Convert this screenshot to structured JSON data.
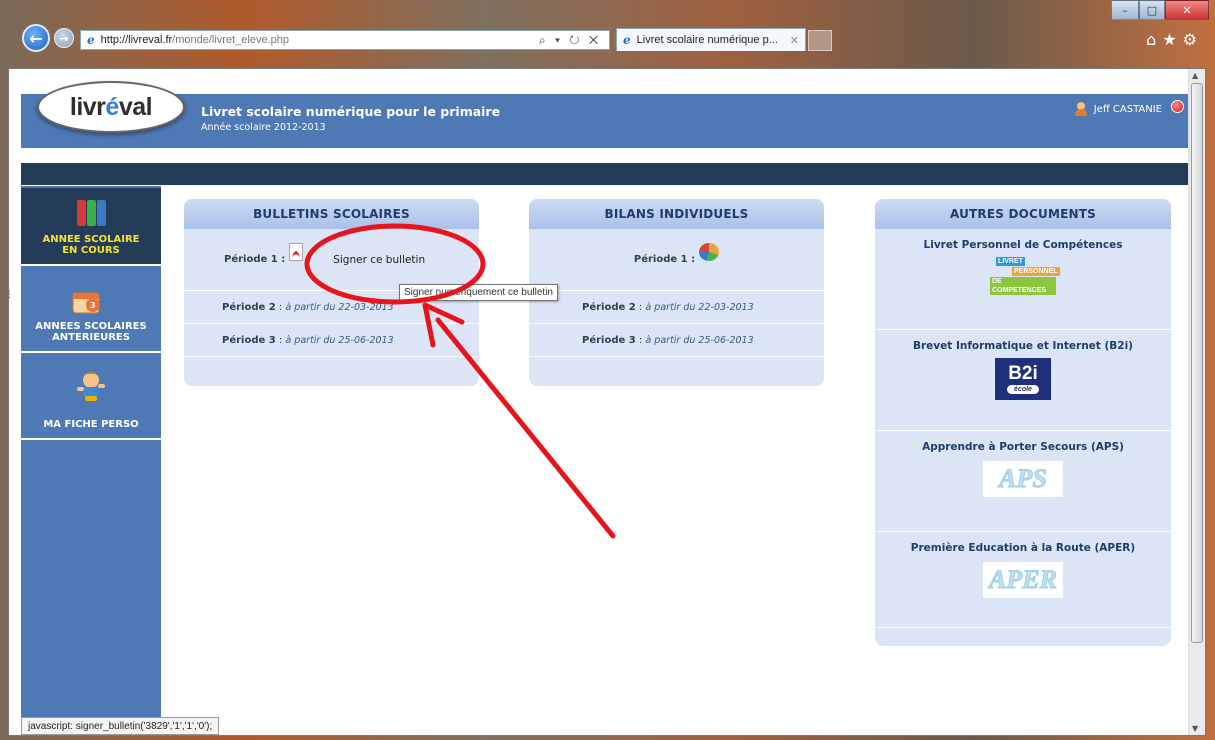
{
  "browser": {
    "url_host": "http://livreval.fr",
    "url_path": "/monde/livret_eleve.php",
    "tab_title": "Livret scolaire numérique p...",
    "status_text": "javascript: signer_bulletin('3829','1','1','0');"
  },
  "header": {
    "logo_text": "livréval",
    "title": "Livret scolaire numérique pour le primaire",
    "subtitle": "Année scolaire 2012-2013",
    "user_name": "Jeff CASTANIE"
  },
  "sidebar": {
    "items": [
      {
        "label_line1": "ANNEE SCOLAIRE",
        "label_line2": "EN COURS"
      },
      {
        "label_line1": "ANNEES SCOLAIRES",
        "label_line2": "ANTERIEURES"
      },
      {
        "label_line1": "MA FICHE PERSO",
        "label_line2": ""
      }
    ]
  },
  "bulletins": {
    "title": "BULLETINS SCOLAIRES",
    "p1_label": "Période 1 :",
    "sign_link": "Signer ce bulletin",
    "p2_label": "Période 2",
    "p2_date": "à partir du 22-03-2013",
    "p3_label": "Période 3",
    "p3_date": "à partir du 25-06-2013"
  },
  "bilans": {
    "title": "BILANS INDIVIDUELS",
    "p1_label": "Période 1 :",
    "p2_label": "Période 2",
    "p2_date": "à partir du 22-03-2013",
    "p3_label": "Période 3",
    "p3_date": "à partir du 25-06-2013"
  },
  "autres": {
    "title": "AUTRES DOCUMENTS",
    "docs": [
      {
        "name": "Livret Personnel de Compétences"
      },
      {
        "name": "Brevet Informatique et Internet (B2i)"
      },
      {
        "name": "Apprendre à Porter Secours (APS)"
      },
      {
        "name": "Première Education à la Route (APER)"
      }
    ],
    "lpc_logo": [
      "LIVRET",
      "PERSONNEL",
      "DE COMPETENCES"
    ],
    "b2i_logo": {
      "big": "B2i",
      "small": "école"
    },
    "aps_logo": "APS",
    "aper_logo": "APER"
  },
  "tooltip": "Signer numériquement ce bulletin",
  "colors": {
    "header": "#4e79b4",
    "dark_bar": "#253c58",
    "panel": "#dbe5f5",
    "active_label": "#f7e23a",
    "annotation": "#e8141b"
  }
}
